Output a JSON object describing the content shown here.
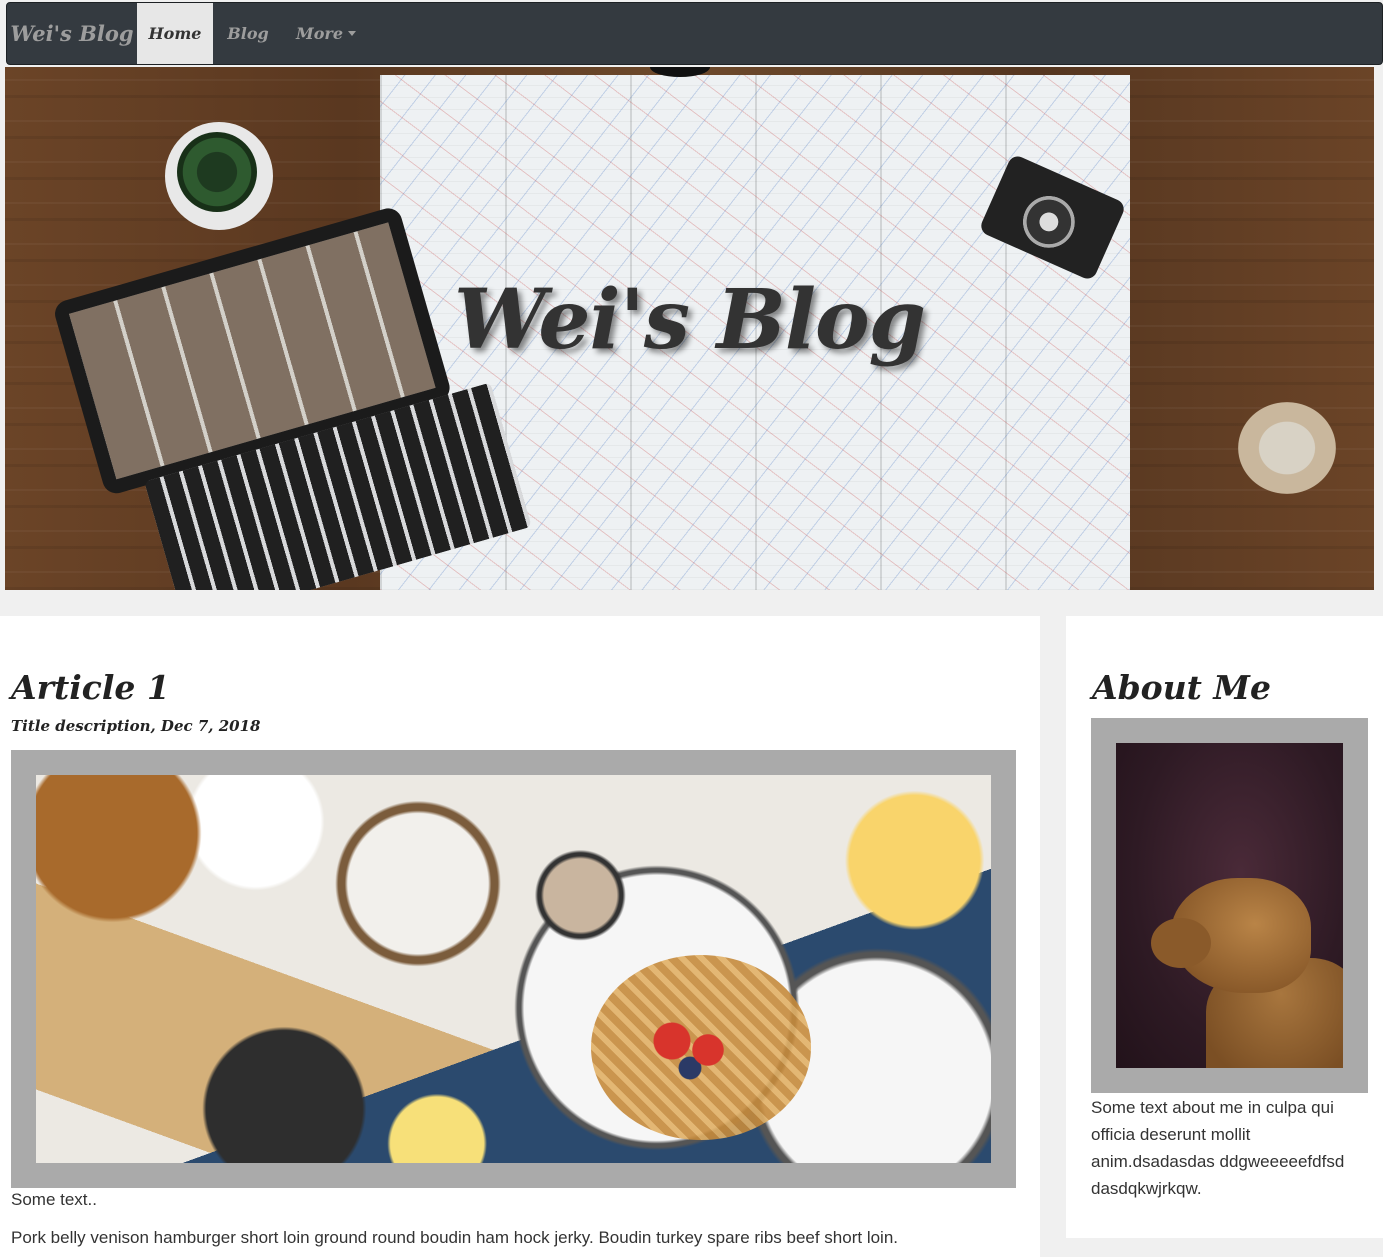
{
  "navbar": {
    "brand": "Wei's Blog",
    "items": [
      {
        "label": "Home",
        "active": true
      },
      {
        "label": "Blog",
        "active": false
      },
      {
        "label": "More",
        "active": false,
        "has_dropdown": true
      }
    ]
  },
  "hero": {
    "title": "Wei's Blog"
  },
  "article": {
    "title": "Article 1",
    "subtitle": "Title description, Dec 7, 2018",
    "image_alt": "breakfast-table-image",
    "paragraphs": [
      "Some text..",
      "Pork belly venison hamburger short loin ground round boudin ham hock jerky. Boudin turkey spare ribs beef short loin."
    ]
  },
  "sidebar": {
    "title": "About Me",
    "image_alt": "dog-portrait-image",
    "text": "Some text about me in culpa qui officia deserunt mollit anim.dsadasdas ddgweeeeefdfsd dasdqkwjrkqw."
  },
  "colors": {
    "navbar_bg": "#343a40",
    "nav_active_bg": "#e7e7e7",
    "page_bg": "#f0f0f0",
    "frame_bg": "#aaaaaa",
    "title_text": "#333333"
  }
}
